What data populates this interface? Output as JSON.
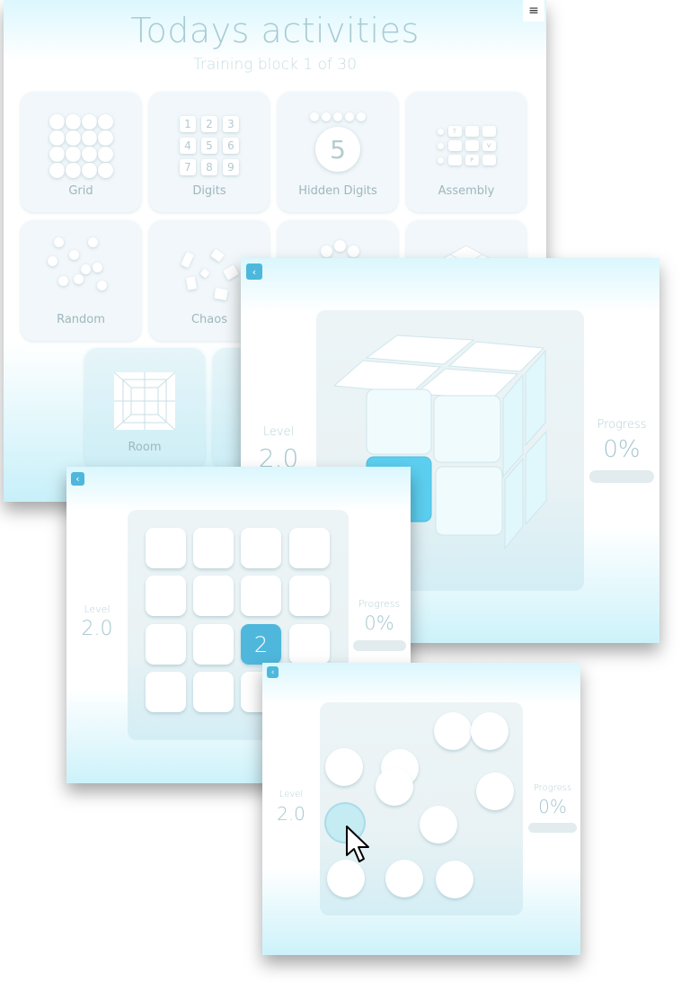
{
  "main": {
    "title": "Todays activities",
    "subtitle": "Training block 1 of 30",
    "menu_icon": "hamburger-menu-icon",
    "tiles": [
      {
        "label": "Grid",
        "icon": "dot-grid-icon"
      },
      {
        "label": "Digits",
        "icon": "number-keypad-icon",
        "digits": [
          "1",
          "2",
          "3",
          "4",
          "5",
          "6",
          "7",
          "8",
          "9"
        ]
      },
      {
        "label": "Hidden Digits",
        "icon": "hidden-digit-icon",
        "digit": "5"
      },
      {
        "label": "Assembly",
        "icon": "assembly-icon",
        "letters": [
          "T",
          "V",
          "P"
        ]
      },
      {
        "label": "Random",
        "icon": "random-dots-icon"
      },
      {
        "label": "Chaos",
        "icon": "chaos-shapes-icon"
      },
      {
        "label": "",
        "icon": "dots-arc-icon"
      },
      {
        "label": "",
        "icon": "3d-grid-icon"
      },
      {
        "label": "Room",
        "icon": "room-grid-icon"
      },
      {
        "label": "",
        "icon": "unknown-icon"
      }
    ]
  },
  "cube_panel": {
    "back_icon": "chevron-left-icon",
    "level_label": "Level",
    "level_value": "2.0",
    "progress_label": "Progress",
    "progress_value": "0%",
    "progress_fraction": 0,
    "accent_color": "#5ccff0"
  },
  "grid_panel": {
    "back_icon": "chevron-left-icon",
    "level_label": "Level",
    "level_value": "2.0",
    "progress_label": "Progress",
    "progress_value": "0%",
    "progress_fraction": 0,
    "active_cell_value": "2",
    "accent_color": "#4fb7dc"
  },
  "random_panel": {
    "back_icon": "chevron-left-icon",
    "level_label": "Level",
    "level_value": "2.0",
    "progress_label": "Progress",
    "progress_value": "0%",
    "progress_fraction": 0
  }
}
